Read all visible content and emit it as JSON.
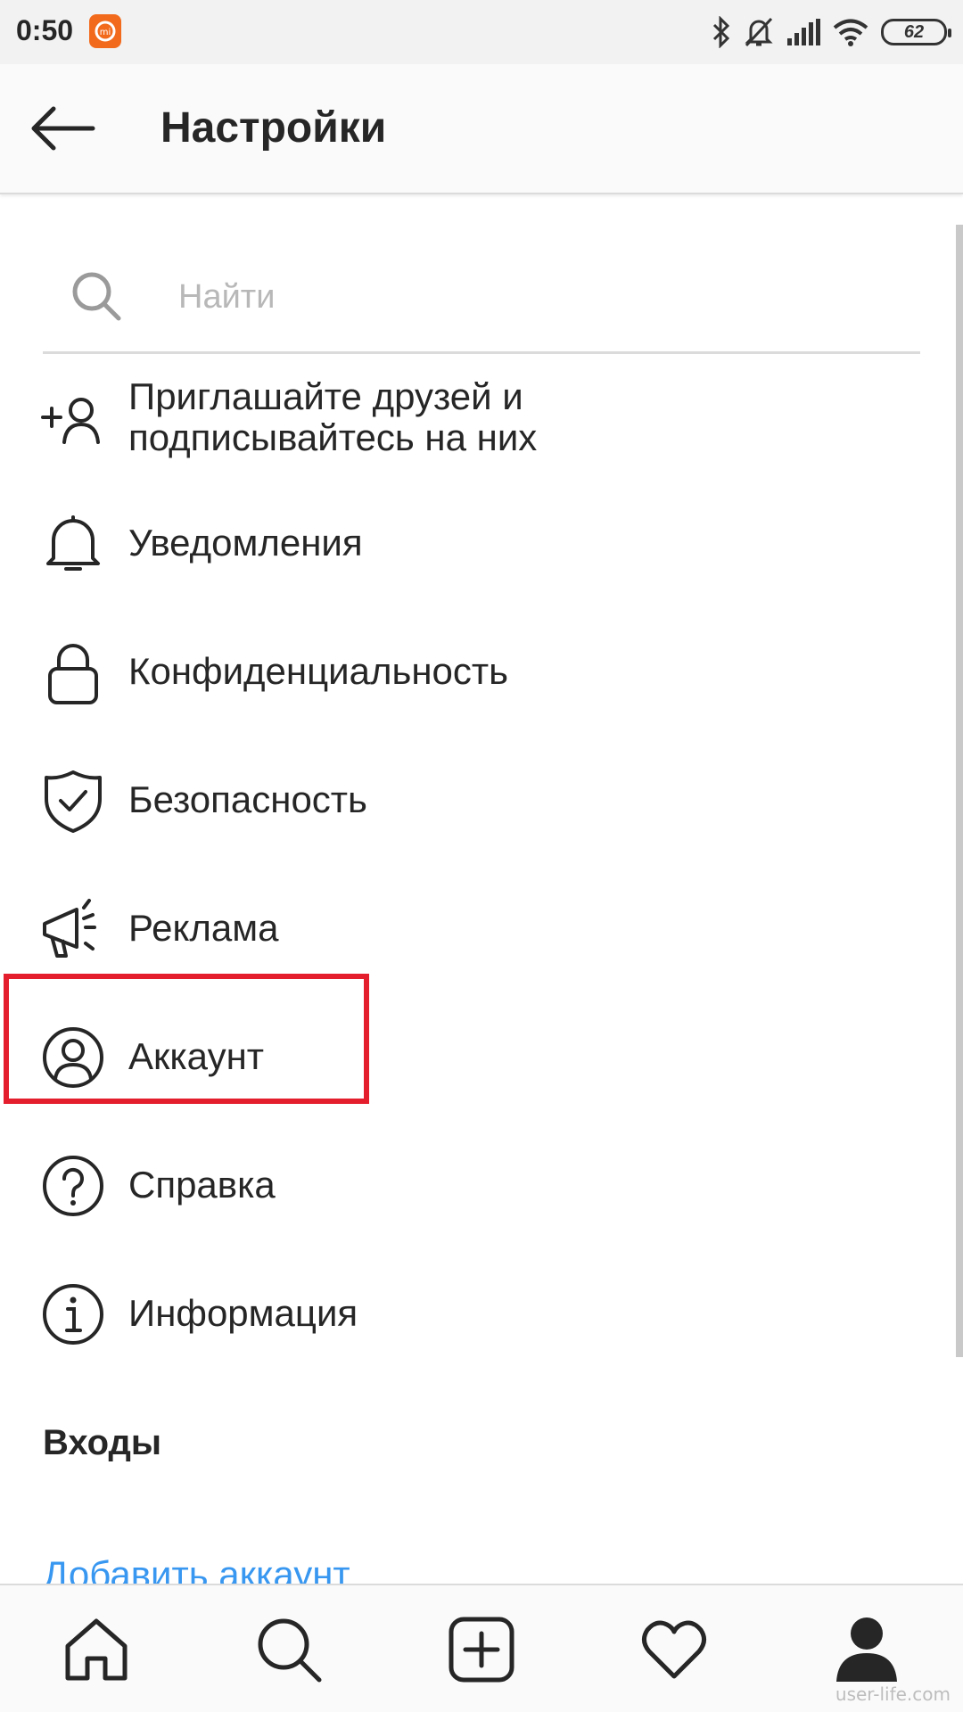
{
  "status_bar": {
    "time": "0:50",
    "app_badge": "mi",
    "battery_level": "62"
  },
  "header": {
    "title": "Настройки",
    "back_icon": "arrow-left-icon"
  },
  "search": {
    "placeholder": "Найти",
    "value": ""
  },
  "menu": {
    "items": [
      {
        "label_line1": "Приглашайте друзей и",
        "label_line2": "подписывайтесь на них",
        "icon": "add-person-icon"
      },
      {
        "label": "Уведомления",
        "icon": "bell-icon"
      },
      {
        "label": "Конфиденциальность",
        "icon": "lock-icon"
      },
      {
        "label": "Безопасность",
        "icon": "shield-check-icon"
      },
      {
        "label": "Реклама",
        "icon": "megaphone-icon"
      },
      {
        "label": "Аккаунт",
        "icon": "account-circle-icon"
      },
      {
        "label": "Справка",
        "icon": "help-circle-icon"
      },
      {
        "label": "Информация",
        "icon": "info-circle-icon"
      }
    ]
  },
  "logins": {
    "section_title": "Входы",
    "add_account": "Добавить аккаунт"
  },
  "bottom_nav": {
    "items": [
      "home-icon",
      "search-icon",
      "add-post-icon",
      "heart-icon",
      "profile-icon"
    ]
  },
  "watermark": "user-life.com",
  "colors": {
    "highlight": "#e41e2d",
    "link": "#3897f0",
    "text": "#262626",
    "mi_badge": "#f26b1d"
  }
}
